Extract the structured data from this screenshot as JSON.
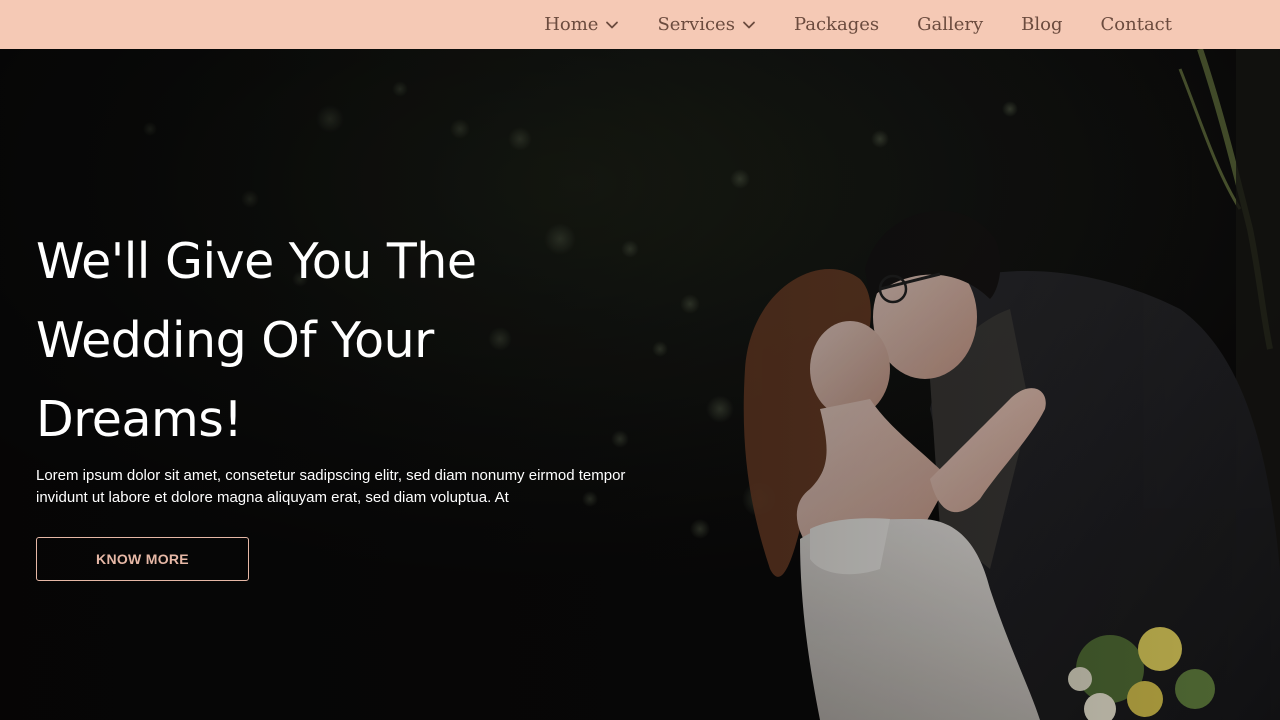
{
  "colors": {
    "nav_bg": "#f5c9b5",
    "nav_text": "#6b4b3e",
    "button_accent": "#e6b8a6"
  },
  "nav": {
    "items": [
      {
        "label": "Home",
        "dropdown": true,
        "icon": "chevron-down-icon"
      },
      {
        "label": "Services",
        "dropdown": true,
        "icon": "chevron-down-icon"
      },
      {
        "label": "Packages"
      },
      {
        "label": "Gallery"
      },
      {
        "label": "Blog"
      },
      {
        "label": "Contact"
      }
    ]
  },
  "hero": {
    "title": "We'll Give You The Wedding Of Your Dreams!",
    "text": "Lorem ipsum dolor sit amet, consetetur sadipscing elitr, sed diam nonumy eirmod tempor invidunt ut labore et dolore magna aliquyam erat, sed diam voluptua. At",
    "button_label": "KNOW MORE",
    "image_icon": "wedding-couple-photo"
  }
}
